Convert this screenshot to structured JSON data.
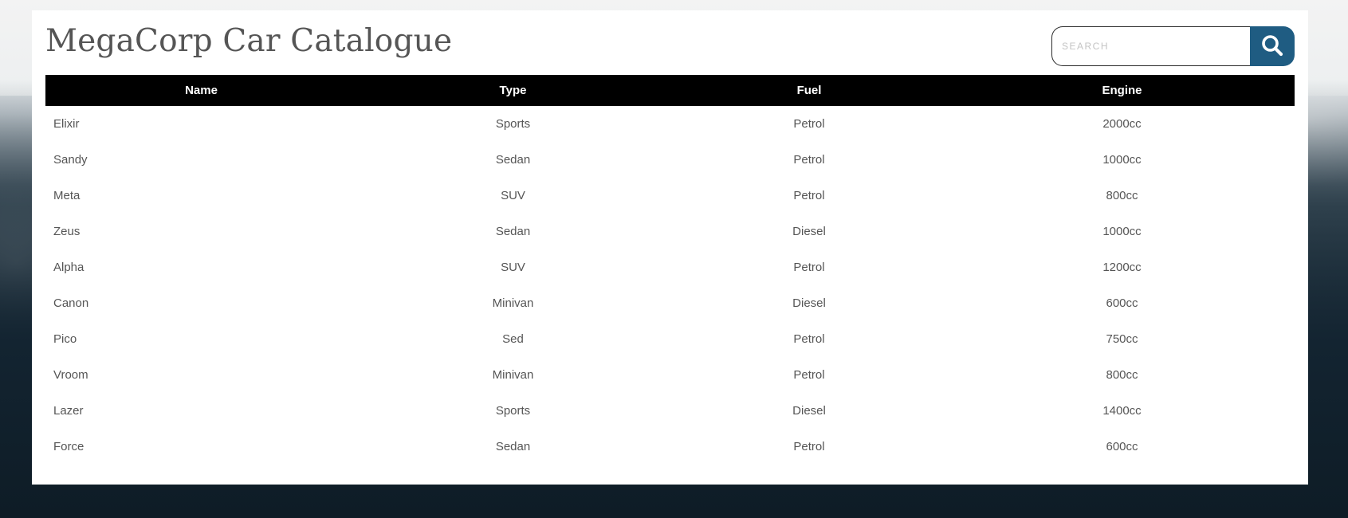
{
  "header": {
    "title": "MegaCorp Car Catalogue"
  },
  "search": {
    "placeholder": "SEARCH",
    "value": "",
    "icon": "search-icon"
  },
  "colors": {
    "header_bg": "#000000",
    "header_text": "#ffffff",
    "search_button": "#1f5c82",
    "title_text": "#555555"
  },
  "table": {
    "columns": [
      "Name",
      "Type",
      "Fuel",
      "Engine"
    ],
    "rows": [
      [
        "Elixir",
        "Sports",
        "Petrol",
        "2000cc"
      ],
      [
        "Sandy",
        "Sedan",
        "Petrol",
        "1000cc"
      ],
      [
        "Meta",
        "SUV",
        "Petrol",
        "800cc"
      ],
      [
        "Zeus",
        "Sedan",
        "Diesel",
        "1000cc"
      ],
      [
        "Alpha",
        "SUV",
        "Petrol",
        "1200cc"
      ],
      [
        "Canon",
        "Minivan",
        "Diesel",
        "600cc"
      ],
      [
        "Pico",
        "Sed",
        "Petrol",
        "750cc"
      ],
      [
        "Vroom",
        "Minivan",
        "Petrol",
        "800cc"
      ],
      [
        "Lazer",
        "Sports",
        "Diesel",
        "1400cc"
      ],
      [
        "Force",
        "Sedan",
        "Petrol",
        "600cc"
      ]
    ]
  }
}
